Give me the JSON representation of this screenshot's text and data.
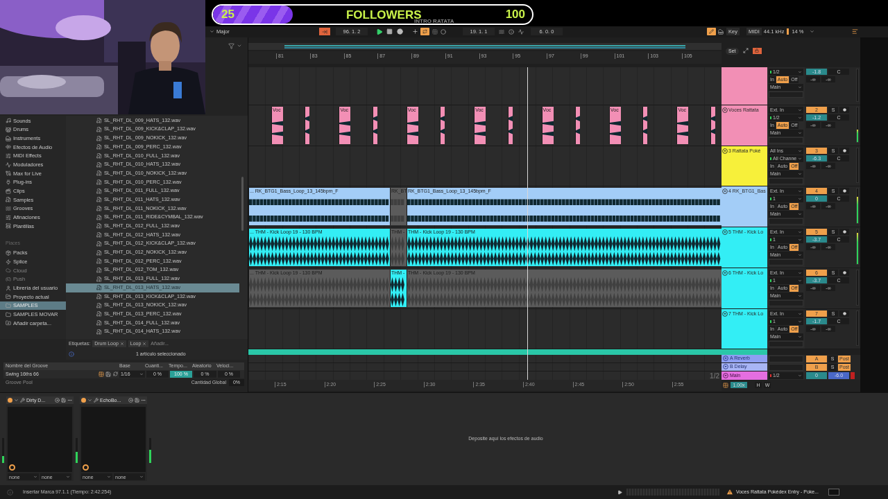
{
  "overlay": {
    "count": "25",
    "title": "FOLLOWERS",
    "goal": "100",
    "subtitle": "INTRO RATATA",
    "level": 0.25
  },
  "control_bar": {
    "scale": "Major",
    "follow_on": true,
    "position": "96. 1. 2",
    "loop_switch_on": true,
    "loop_start": "19. 1. 1",
    "loop_length": "6. 0. 0",
    "draw_mode_on": true,
    "key_label": "Key",
    "midi_label": "MIDI",
    "sample_rate": "44.1 kHz",
    "cpu": "14 %"
  },
  "browser": {
    "categories": [
      "Sounds",
      "Drums",
      "Instruments",
      "Efectos de Audio",
      "MIDI Effects",
      "Moduladores",
      "Max for Live",
      "Plug-ins",
      "Clips",
      "Samples",
      "Grooves",
      "Afinaciones",
      "Plantillas"
    ],
    "places_heading": "Places",
    "places": [
      {
        "label": "Packs",
        "disabled": false,
        "selected": false
      },
      {
        "label": "Splice",
        "disabled": false,
        "selected": false
      },
      {
        "label": "Cloud",
        "disabled": true,
        "selected": false
      },
      {
        "label": "Push",
        "disabled": true,
        "selected": false
      },
      {
        "label": "Librería del usuario",
        "disabled": false,
        "selected": false
      },
      {
        "label": "Proyecto actual",
        "disabled": false,
        "selected": false
      },
      {
        "label": "SAMPLES",
        "disabled": false,
        "selected": true
      },
      {
        "label": "SAMPLES MOVAR",
        "disabled": false,
        "selected": false
      },
      {
        "label": "Añadir carpeta...",
        "disabled": false,
        "selected": false
      }
    ],
    "files": [
      {
        "name": "SL_RHT_DL_009_HATS_132.wav",
        "selected": false
      },
      {
        "name": "SL_RHT_DL_009_KICK&CLAP_132.wav",
        "selected": false
      },
      {
        "name": "SL_RHT_DL_009_NOKICK_132.wav",
        "selected": false
      },
      {
        "name": "SL_RHT_DL_009_PERC_132.wav",
        "selected": false
      },
      {
        "name": "SL_RHT_DL_010_FULL_132.wav",
        "selected": false
      },
      {
        "name": "SL_RHT_DL_010_HATS_132.wav",
        "selected": false
      },
      {
        "name": "SL_RHT_DL_010_NOKICK_132.wav",
        "selected": false
      },
      {
        "name": "SL_RHT_DL_010_PERC_132.wav",
        "selected": false
      },
      {
        "name": "SL_RHT_DL_011_FULL_132.wav",
        "selected": false
      },
      {
        "name": "SL_RHT_DL_011_HATS_132.wav",
        "selected": false
      },
      {
        "name": "SL_RHT_DL_011_NOKICK_132.wav",
        "selected": false
      },
      {
        "name": "SL_RHT_DL_011_RIDE&CYMBAL_132.wav",
        "selected": false
      },
      {
        "name": "SL_RHT_DL_012_FULL_132.wav",
        "selected": false
      },
      {
        "name": "SL_RHT_DL_012_HATS_132.wav",
        "selected": false
      },
      {
        "name": "SL_RHT_DL_012_KICK&CLAP_132.wav",
        "selected": false
      },
      {
        "name": "SL_RHT_DL_012_NOKICK_132.wav",
        "selected": false
      },
      {
        "name": "SL_RHT_DL_012_PERC_132.wav",
        "selected": false
      },
      {
        "name": "SL_RHT_DL_012_TOM_132.wav",
        "selected": false
      },
      {
        "name": "SL_RHT_DL_013_FULL_132.wav",
        "selected": false
      },
      {
        "name": "SL_RHT_DL_013_HATS_132.wav",
        "selected": true
      },
      {
        "name": "SL_RHT_DL_013_KICK&CLAP_132.wav",
        "selected": false
      },
      {
        "name": "SL_RHT_DL_013_NOKICK_132.wav",
        "selected": false
      },
      {
        "name": "SL_RHT_DL_013_PERC_132.wav",
        "selected": false
      },
      {
        "name": "SL_RHT_DL_014_FULL_132.wav",
        "selected": false
      },
      {
        "name": "SL_RHT_DL_014_HATS_132.wav",
        "selected": false
      }
    ],
    "tags_label": "Etiquetas:",
    "tags": [
      "Drum Loop",
      "Loop"
    ],
    "tag_placeholder": "Añadir...",
    "status": "1 artículo seleccionado"
  },
  "groove_pool": {
    "columns": [
      "Nombre del Groove",
      "Base",
      "Cuanti...",
      "Tempo...",
      "Aleatorio",
      "Veloci..."
    ],
    "row": {
      "name": "Swing 16ths 66",
      "base": "1/16",
      "quantize": "0 %",
      "timing": "100 %",
      "random": "0 %",
      "velocity": "0 %"
    },
    "footer": "Groove Pool",
    "global_label": "Cantidad Global",
    "global_value": "0%"
  },
  "arrangement": {
    "bars": [
      "81",
      "83",
      "85",
      "87",
      "89",
      "91",
      "93",
      "95",
      "97",
      "99",
      "101",
      "103",
      "105"
    ],
    "set_button": "Set",
    "tracks": [
      {
        "color": "#f28fb5",
        "channel": "1/2",
        "monitor": [
          {
            "label": "In",
            "selected": false
          },
          {
            "label": "Auto",
            "selected": true
          },
          {
            "label": "Off",
            "selected": false
          }
        ],
        "output": "Main",
        "volume": "-1.8",
        "pan": "C",
        "sends": [
          "-∞",
          "-∞"
        ]
      },
      {
        "kind": "vocal",
        "name": "Voces Rattata",
        "color": "#f28fb5",
        "input": "Ext. In",
        "channel": "1/2",
        "monitor": [
          {
            "label": "In",
            "selected": false
          },
          {
            "label": "Auto",
            "selected": true
          },
          {
            "label": "Off",
            "selected": false
          }
        ],
        "output": "Main",
        "number": "2",
        "solo": "S",
        "volume": "-1.2",
        "pan": "C",
        "sends": [
          "-∞",
          "-∞"
        ],
        "meter": {
          "level": 0.35
        },
        "clips": [
          {
            "label": "Voc",
            "active": true
          },
          {
            "active": true
          },
          {
            "label": "Voc",
            "active": true
          },
          {
            "active": true
          },
          {
            "label": "Voc",
            "active": true
          },
          {
            "active": true
          },
          {
            "label": "Voc",
            "active": true
          },
          {
            "active": true
          },
          {
            "label": "Voc",
            "active": true
          },
          {
            "active": true
          },
          {
            "label": "Voc",
            "active": true
          },
          {
            "active": true
          },
          {
            "label": "Voc",
            "active": true
          },
          {
            "active": true
          }
        ]
      },
      {
        "name": "3 Rattata Poké",
        "color": "#f7f03a",
        "input": "All Ins",
        "channel": "All Channe",
        "monitor": [
          {
            "label": "In",
            "selected": false
          },
          {
            "label": "Auto",
            "selected": false
          },
          {
            "label": "Off",
            "selected": true
          }
        ],
        "output": "Main",
        "number": "3",
        "solo": "S",
        "volume": "-6.3",
        "pan": "C",
        "sends": [
          "-∞",
          "-∞"
        ]
      },
      {
        "kind": "bass",
        "name": "4 RK_BTG1_Bas",
        "color": "#a3cdf7",
        "input": "Ext. In",
        "channel": "1",
        "monitor": [
          {
            "label": "In",
            "selected": false
          },
          {
            "label": "Auto",
            "selected": false
          },
          {
            "label": "Off",
            "selected": true
          }
        ],
        "output": "Main",
        "number": "4",
        "solo": "S",
        "volume": "0",
        "pan": "C",
        "sends": [
          "-∞",
          "-∞"
        ],
        "meter": {
          "level": 0.75
        },
        "clips": [
          {
            "label": "... RK_BTG1_Bass_Loop_13_145bpm_F",
            "active": true
          },
          {
            "label": "RK_BT",
            "active": false
          },
          {
            "label": "RK_BTG1_Bass_Loop_13_145bpm_F",
            "active": true
          }
        ]
      },
      {
        "kind": "drum",
        "name": "5 THM - Kick Lo",
        "color": "#33eef5",
        "input": "Ext. In",
        "channel": "1",
        "monitor": [
          {
            "label": "In",
            "selected": false
          },
          {
            "label": "Auto",
            "selected": false
          },
          {
            "label": "Off",
            "selected": true
          }
        ],
        "output": "Main",
        "number": "5",
        "solo": "S",
        "volume": "-3.7",
        "pan": "C",
        "sends": [
          "-∞",
          "-∞"
        ],
        "meter": {
          "level": 0.9
        },
        "clips": [
          {
            "label": "... THM - Kick Loop 19 - 130 BPM",
            "active": true
          },
          {
            "label": "THM -",
            "active": false
          },
          {
            "label": "THM - Kick Loop 19 - 130 BPM",
            "active": true
          }
        ]
      },
      {
        "kind": "drum",
        "name": "6 THM - Kick Lo",
        "color": "#33eef5",
        "input": "Ext. In",
        "channel": "1",
        "monitor": [
          {
            "label": "In",
            "selected": false
          },
          {
            "label": "Auto",
            "selected": false
          },
          {
            "label": "Off",
            "selected": true
          }
        ],
        "output": "Main",
        "number": "6",
        "solo": "S",
        "volume": "-3.7",
        "pan": "C",
        "sends": [
          "-∞",
          "-∞"
        ],
        "clips": [
          {
            "label": "... THM - Kick Loop 19 - 130 BPM",
            "active": false
          },
          {
            "label": "THM -",
            "active": true
          },
          {
            "label": "THM - Kick Loop 19 - 130 BPM",
            "active": false
          }
        ]
      },
      {
        "name": "7 THM - Kick Lo",
        "color": "#33eef5",
        "input": "Ext. In",
        "channel": "1",
        "monitor": [
          {
            "label": "In",
            "selected": false
          },
          {
            "label": "Auto",
            "selected": false
          },
          {
            "label": "Off",
            "selected": true
          }
        ],
        "output": "Main",
        "number": "7",
        "solo": "S",
        "volume": "-1.7",
        "pan": "C",
        "sends": [
          "-∞",
          "-∞"
        ]
      }
    ],
    "returns": [
      {
        "name": "A Reverb",
        "color": "#8e9ff2",
        "letter": "A",
        "solo": "S",
        "send_mode": "Post"
      },
      {
        "name": "B Delay",
        "color": "#a8b5f5",
        "letter": "B",
        "solo": "S",
        "send_mode": "Post"
      }
    ],
    "main": {
      "name": "Main",
      "color": "#e46ee0",
      "channel": "1/2",
      "volume": "0",
      "pan": "-6.0"
    },
    "times": [
      "2:15",
      "2:20",
      "2:25",
      "2:30",
      "2:35",
      "2:40",
      "2:45",
      "2:50",
      "2:55"
    ],
    "zoom_label": "1/2",
    "tempo_scale": "1.00x",
    "h_button": "H",
    "w_button": "W"
  },
  "device_chain": {
    "input_meter": {
      "level": 0.3
    },
    "devices": [
      {
        "name": "Dirty D...",
        "inputs": [
          "none",
          "none"
        ],
        "output_meter": {
          "level": 0.45
        }
      },
      {
        "name": "EchoBo...",
        "inputs": [
          "none",
          "none"
        ],
        "output_meter": {
          "level": 0.55
        }
      }
    ],
    "drop_hint": "Deposite aquí los efectos de audio"
  },
  "status_bar": {
    "message": "Insertar Marca 97.1.1 (Tiempo: 2:42:254)",
    "clip_name": "Voces Rattata Pokédex Entry - Poke..."
  }
}
